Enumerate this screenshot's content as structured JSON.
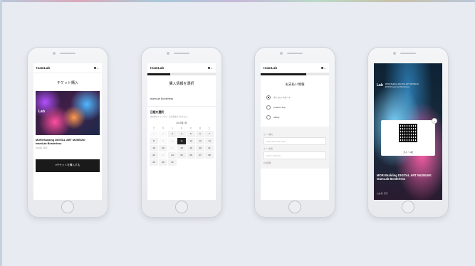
{
  "brand": "teamLab",
  "phone1": {
    "title": "チケット購入",
    "hero_logo": "Lab",
    "event_title_line1": "MORI Building DIGITAL ART MUSEUM:",
    "event_title_line2": "teamLab Borderless",
    "event_sub": "お台場, 東京",
    "buy_button": "eチケットを購入する"
  },
  "phone2": {
    "title": "購入情報を選択",
    "selected_event": "teamLab Borderless",
    "date_section_title": "日程を選択",
    "date_section_note": "表示後のキャンセル・日付変更はできません。",
    "month": "2019年7月",
    "weekdays": [
      "日",
      "月",
      "火",
      "水",
      "木",
      "金",
      "土"
    ],
    "days": [
      "1",
      "2",
      "3",
      "4",
      "5",
      "6",
      "7",
      "8",
      "9",
      "10",
      "11",
      "12",
      "13",
      "14",
      "15",
      "16",
      "17",
      "18",
      "19",
      "20",
      "21",
      "22",
      "23",
      "24",
      "25",
      "26",
      "27",
      "28",
      "29",
      "30",
      "31"
    ]
  },
  "phone3": {
    "title": "お支払い情報",
    "options": [
      "クレジットカード",
      "Amazon Pay",
      "AliPay"
    ],
    "selected_option": "クレジットカード",
    "card_number_label": "カード番号",
    "card_number_placeholder": "0000 0000 0000 0000",
    "card_name_label": "カード名義",
    "card_name_placeholder": "TARO YAMADA",
    "expiry_label": "有効期限"
  },
  "phone4": {
    "header_logo": "Lab",
    "header_line1": "MORI Building DIGITAL ART MUSEUM",
    "header_line2": "EPSON teamLab Borderless",
    "close_glyph": "×",
    "qr_label": "大人・1枚",
    "event_title": "MORI Building DIGITAL ART MUSEUM: teamLab Borderless",
    "event_sub": "お台場, 東京"
  },
  "colors": {
    "background": "#e8ecf2",
    "button": "#1a1a1a"
  }
}
